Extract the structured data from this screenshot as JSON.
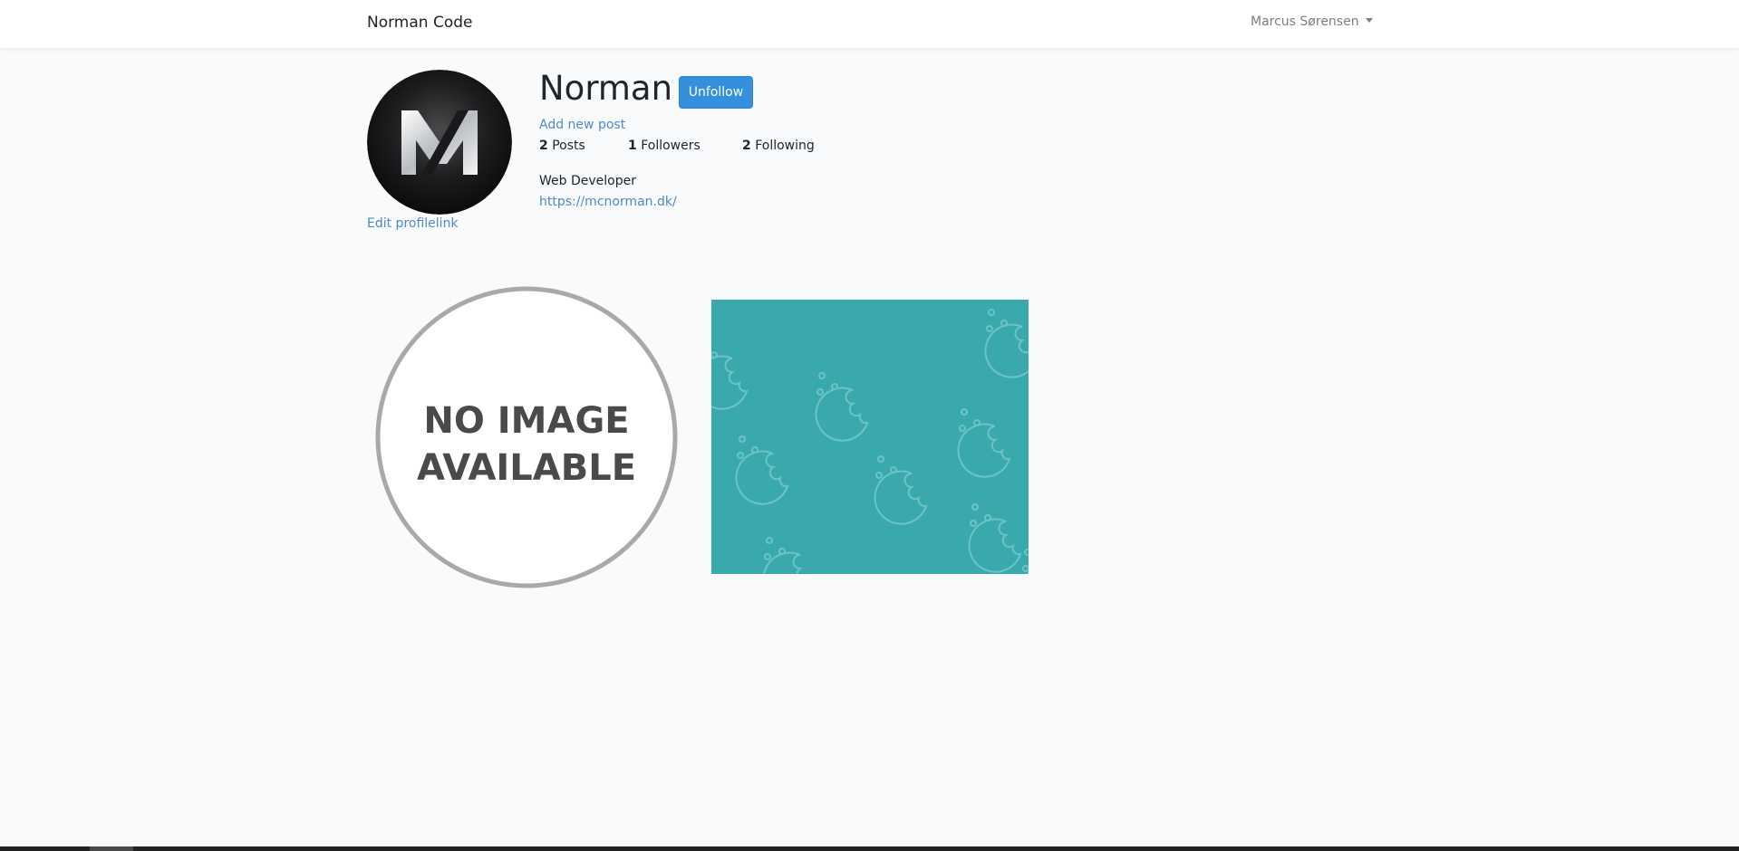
{
  "navbar": {
    "brand": "Norman Code",
    "user_name": "Marcus Sørensen"
  },
  "profile": {
    "username": "Norman",
    "follow_button_label": "Unfollow",
    "add_post_label": "Add new post",
    "edit_profile_label": "Edit profilelink",
    "stats": {
      "posts_count": "2",
      "posts_label": "Posts",
      "followers_count": "1",
      "followers_label": "Followers",
      "following_count": "2",
      "following_label": "Following"
    },
    "bio": "Web Developer",
    "website": "https://mcnorman.dk/"
  },
  "posts": [
    {
      "image": "no-image-placeholder",
      "caption_line1": "NO IMAGE",
      "caption_line2": "AVAILABLE"
    },
    {
      "image": "teal-cookie-pattern"
    }
  ],
  "colors": {
    "accent": "#3490dc",
    "link": "#4f8ac7",
    "page_background": "#f8fafc",
    "post_teal": "#3aa9ad"
  }
}
